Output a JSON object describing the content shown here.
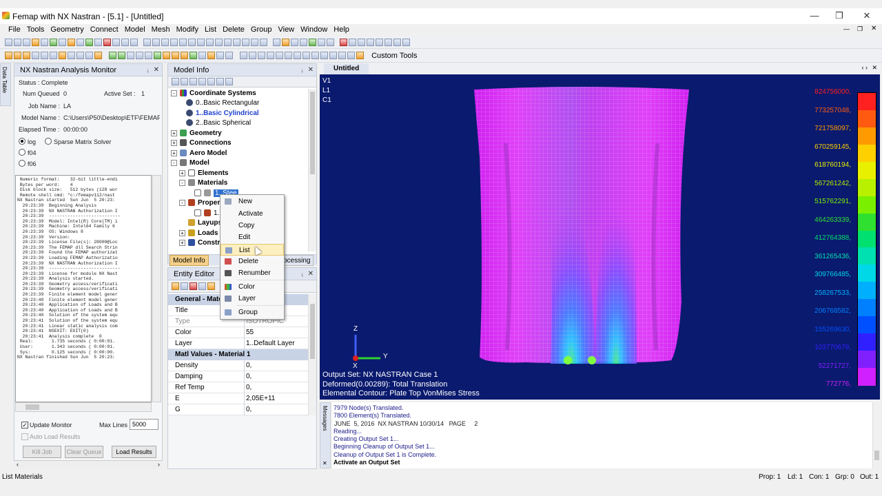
{
  "app": {
    "title": "Femap with NX Nastran - [5.1] - [Untitled]",
    "menu": [
      "File",
      "Tools",
      "Geometry",
      "Connect",
      "Model",
      "Mesh",
      "Modify",
      "List",
      "Delete",
      "Group",
      "View",
      "Window",
      "Help"
    ],
    "custom_tools": "Custom Tools",
    "side_tab": "Data Table"
  },
  "monitor": {
    "title": "NX Nastran Analysis Monitor",
    "status": "Status : Complete",
    "num_queued_label": "Num Queued",
    "num_queued": "0",
    "active_set_label": "Active Set :",
    "active_set": "1",
    "job_name_label": "Job Name :",
    "job_name": "LA",
    "model_name_label": "Model Name :",
    "model_name": "C:\\Users\\P50\\Desktop\\ETF\\FEMAP\\",
    "elapsed_label": "Elapsed Time :",
    "elapsed": "00:00:00",
    "radio_log": "log",
    "radio_sparse": "Sparse Matrix Solver",
    "radio_f04": "f04",
    "radio_f06": "f06",
    "log_lines": [
      " Numeric format:    32-bit little-endi",
      " Bytes per word:    4",
      " Disk block size:   512 bytes (128 wor",
      " Remote shell cmd: \"c:/femapv112/nast",
      "",
      "NX Nastran started  Sun Jun  5 20:23:",
      "  20:23:39  Beginning Analysis",
      "",
      "  20:23:39  NX NASTRAN Authorization I",
      "  20:23:39  ---------------------------",
      "  20:23:39  Model: Intel(R) Core(TM) i",
      "  20:23:39  Machine: Intel64 Family 6",
      "  20:23:39  OS: Windows 8",
      "  20:23:39  Version:",
      "  20:23:39  License File(s): 28000@Loc",
      "",
      "  20:23:39  The FEMAP dll Search Strin",
      "  20:23:39  Found the FEMAP authorizat",
      "  20:23:39  Loading FEMAP Authorizatio",
      "",
      "  20:23:39  NX NASTRAN Authorization I",
      "  20:23:39  ---------------------------",
      "  20:23:39  License for module NX Nast",
      "",
      "  20:23:39  Analysis started.",
      "  20:23:39  Geometry access/verificati",
      "  20:23:39  Geometry access/verificati",
      "  20:23:39  Finite element model gener",
      "  20:23:40  Finite element model gener",
      "  20:23:40  Application of Loads and B",
      "  20:23:40  Application of Loads and B",
      "  20:23:40  Solution of the system equ",
      "  20:23:41  Solution of the system equ",
      "  20:23:41  Linear static analysis com",
      "  20:23:41  NSEXIT: EXIT(0)",
      "  20:23:41  Analysis complete  0",
      " Real:       1.735 seconds ( 0:00:01.",
      " User:       1.343 seconds ( 0:00:01.",
      " Sys:        0.125 seconds ( 0:00:00.",
      "NX Nastran finished Sun Jun  5 20:23:"
    ],
    "update_monitor": "Update Monitor",
    "max_lines_label": "Max Lines",
    "max_lines": "5000",
    "auto_load": "Auto Load Results",
    "kill_job": "Kill Job",
    "clear_queue": "Clear Queue",
    "load_results": "Load Results"
  },
  "model_info": {
    "title": "Model Info",
    "tree": {
      "coord_systems": "Coordinate Systems",
      "cs0": "0..Basic Rectangular",
      "cs1": "1..Basic Cylindrical",
      "cs2": "2..Basic Spherical",
      "geometry": "Geometry",
      "connections": "Connections",
      "aero": "Aero Model",
      "model": "Model",
      "elements": "Elements",
      "materials": "Materials",
      "material1": "1..Stee",
      "properties": "Propert",
      "property1": "1..",
      "layups": "Layups",
      "loads": "Loads",
      "constraints": "Constra"
    },
    "tab_label": "Model Info",
    "tab_other": "ocessing"
  },
  "context_menu": [
    "New",
    "Activate",
    "Copy",
    "Edit",
    "List",
    "Delete",
    "Renumber",
    "Color",
    "Layer",
    "Group"
  ],
  "entity_editor": {
    "title": "Entity Editor",
    "general_cat": "General - Mate",
    "rows_general": [
      {
        "k": "Title",
        "v": ""
      },
      {
        "k": "Type",
        "v": "ISOTROPIC"
      },
      {
        "k": "Color",
        "v": "55"
      },
      {
        "k": "Layer",
        "v": "1..Default Layer"
      }
    ],
    "matl_cat": "Matl Values - Material 1",
    "rows_matl": [
      {
        "k": "Density",
        "v": "0,"
      },
      {
        "k": "Damping",
        "v": "0,"
      },
      {
        "k": "Ref Temp",
        "v": "0,"
      },
      {
        "k": "E",
        "v": "2,05E+11"
      },
      {
        "k": "G",
        "v": "0,"
      }
    ]
  },
  "viewport": {
    "tab": "Untitled",
    "labels": [
      "V1",
      "L1",
      "C1"
    ],
    "output_set": "Output Set: NX NASTRAN Case 1",
    "deformed": "Deformed(0.00289): Total Translation",
    "contour": "Elemental Contour: Plate Top VonMises Stress",
    "axis_z": "Z",
    "axis_y": "Y",
    "axis_x": "X",
    "legend": [
      "824756000,",
      "773257048,",
      "721758097,",
      "670259145,",
      "618760194,",
      "567261242,",
      "515762291,",
      "464263339,",
      "412764388,",
      "361265436,",
      "309766485,",
      "258267533,",
      "206768582,",
      "155269630,",
      "103770679,",
      "52271727,",
      "772776,"
    ],
    "legend_colors": [
      "#ff2020",
      "#ff5a10",
      "#ff9a00",
      "#ffd000",
      "#e8f000",
      "#b8f000",
      "#7af000",
      "#30e030",
      "#00e070",
      "#00e0b0",
      "#00d8e8",
      "#00b0ff",
      "#0080ff",
      "#0050ff",
      "#3020ff",
      "#8020ff",
      "#d020ff"
    ]
  },
  "messages": {
    "side_label": "Messages",
    "lines": [
      "7979 Node(s) Translated.",
      "7800 Element(s) Translated.",
      "JUNE  5, 2016  NX NASTRAN 10/30/14   PAGE     2",
      "Reading...",
      "Creating Output Set 1...",
      "Beginning Cleanup of Output Set 1...",
      "Cleanup of Output Set 1 is Complete.",
      "Activate an Output Set"
    ]
  },
  "status": {
    "left": "List Materials",
    "prop": "Prop: 1",
    "ld": "Ld: 1",
    "con": "Con: 1",
    "grp": "Grp: 0",
    "out": "Out: 1"
  }
}
